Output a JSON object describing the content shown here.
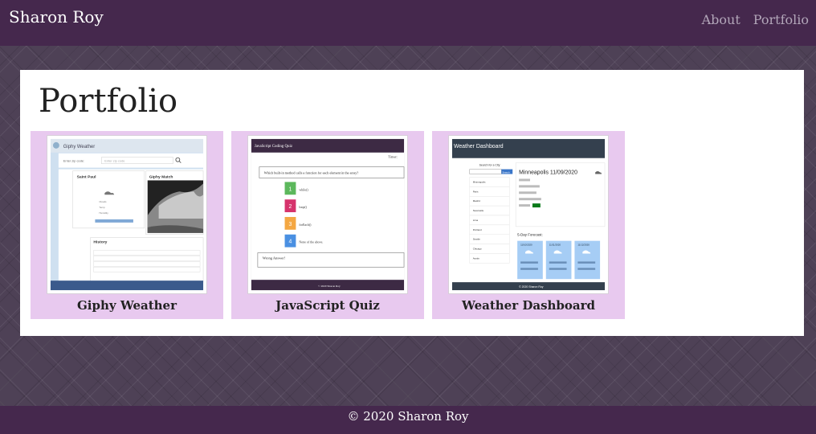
{
  "nav": {
    "brand": "Sharon Roy",
    "links": [
      {
        "label": "About"
      },
      {
        "label": "Portfolio"
      }
    ]
  },
  "main": {
    "title": "Portfolio",
    "projects": [
      {
        "label": "Giphy Weather",
        "thumb": {
          "app_title": "Giphy Weather",
          "search_placeholder": "Enter zip code",
          "city": "Saint Paul",
          "giphy_title": "Giphy Match",
          "history_title": "History"
        }
      },
      {
        "label": "JavaScript Quiz",
        "thumb": {
          "app_title": "JavaScript Coding Quiz",
          "timer": "Timer:",
          "question": "Which built-in method calls a function for each element in the array?",
          "answers": [
            "while()",
            "loop()",
            "forEach()",
            "None of the above."
          ],
          "feedback": "Wrong Answer!",
          "footer": "© 2020 Sharon Roy"
        }
      },
      {
        "label": "Weather Dashboard",
        "thumb": {
          "app_title": "Weather Dashboard",
          "search_label": "Search for a City:",
          "search_button": "Search",
          "cities": [
            "Minneapolis",
            "Paris",
            "Madrid",
            "Newcastle",
            "Lima",
            "Portland",
            "Seattle",
            "Chicago",
            "Austin"
          ],
          "current": "Minneapolis 11/09/2020",
          "forecast_title": "5-Day Forecast:",
          "forecast_dates": [
            "11/10/2020",
            "11/11/2020",
            "11/12/2020"
          ],
          "footer": "© 2020 Sharon Roy"
        }
      }
    ]
  },
  "footer": {
    "text": "© 2020 Sharon Roy"
  },
  "colors": {
    "nav": "#45284d",
    "card": "#e8c9ef",
    "link": "#b2a6b9"
  }
}
